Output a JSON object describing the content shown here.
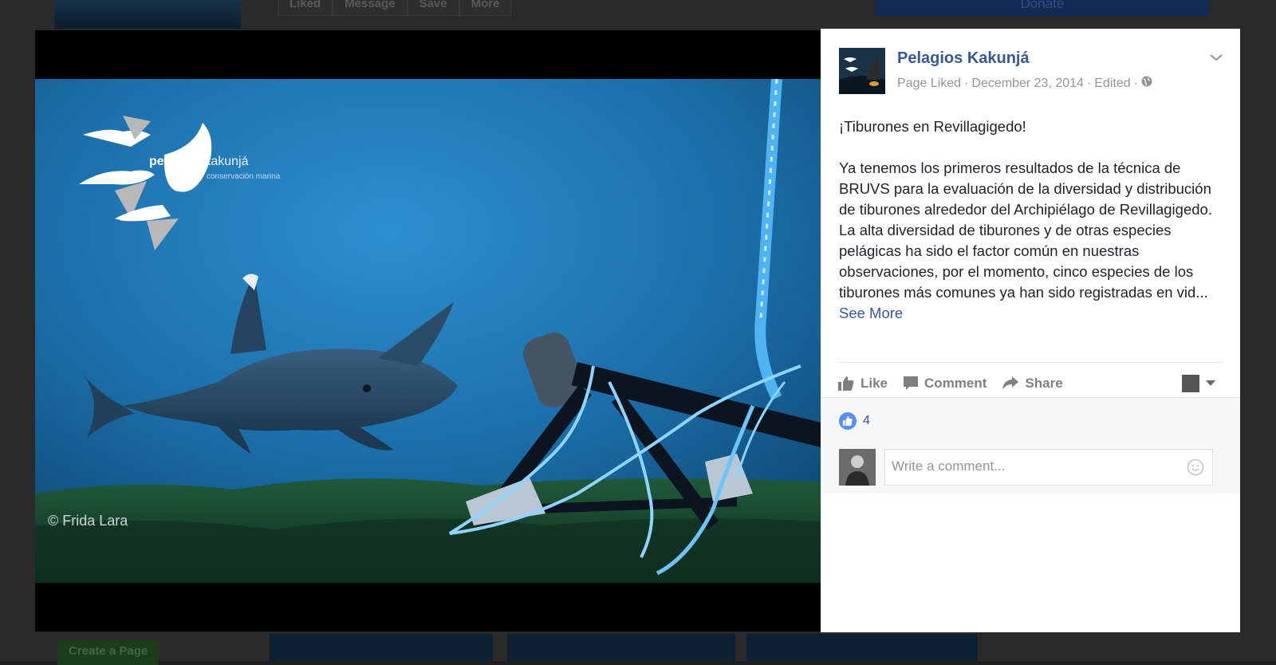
{
  "background": {
    "actions": [
      "Liked",
      "Message",
      "Save",
      "More"
    ],
    "donate_label": "Donate",
    "create_page_label": "Create a Page"
  },
  "photo": {
    "logo_brand": "pelagios",
    "logo_brand2": "kakunjá",
    "logo_tagline": "conservación marina",
    "credit": "© Frida Lara"
  },
  "post": {
    "page_name": "Pelagios Kakunjá",
    "meta_page_liked": "Page Liked",
    "meta_date": "December 23, 2014",
    "meta_edited": "Edited",
    "headline": "¡Tiburones en Revillagigedo!",
    "body": "Ya tenemos los primeros resultados de la técnica de BRUVS para la evaluación de la diversidad y distribución de tiburones alrededor del Archipiélago de Revillagigedo. La alta diversidad de tiburones y de otras especies pelágicas ha sido el factor común en nuestras observaciones, por el momento, cinco especies de los tiburones más comunes ya han sido registradas en vid...",
    "see_more": "See More"
  },
  "actions": {
    "like": "Like",
    "comment": "Comment",
    "share": "Share"
  },
  "reactions": {
    "count": "4"
  },
  "comment_input": {
    "placeholder": "Write a comment..."
  },
  "icons": [
    "chevron-down-icon",
    "globe-icon",
    "like-icon",
    "comment-icon",
    "share-icon",
    "caret-down-icon",
    "smiley-icon"
  ],
  "colors": {
    "link": "#365899",
    "text": "#1d2129",
    "meta": "#90949c",
    "like_blue": "#5890ff"
  }
}
